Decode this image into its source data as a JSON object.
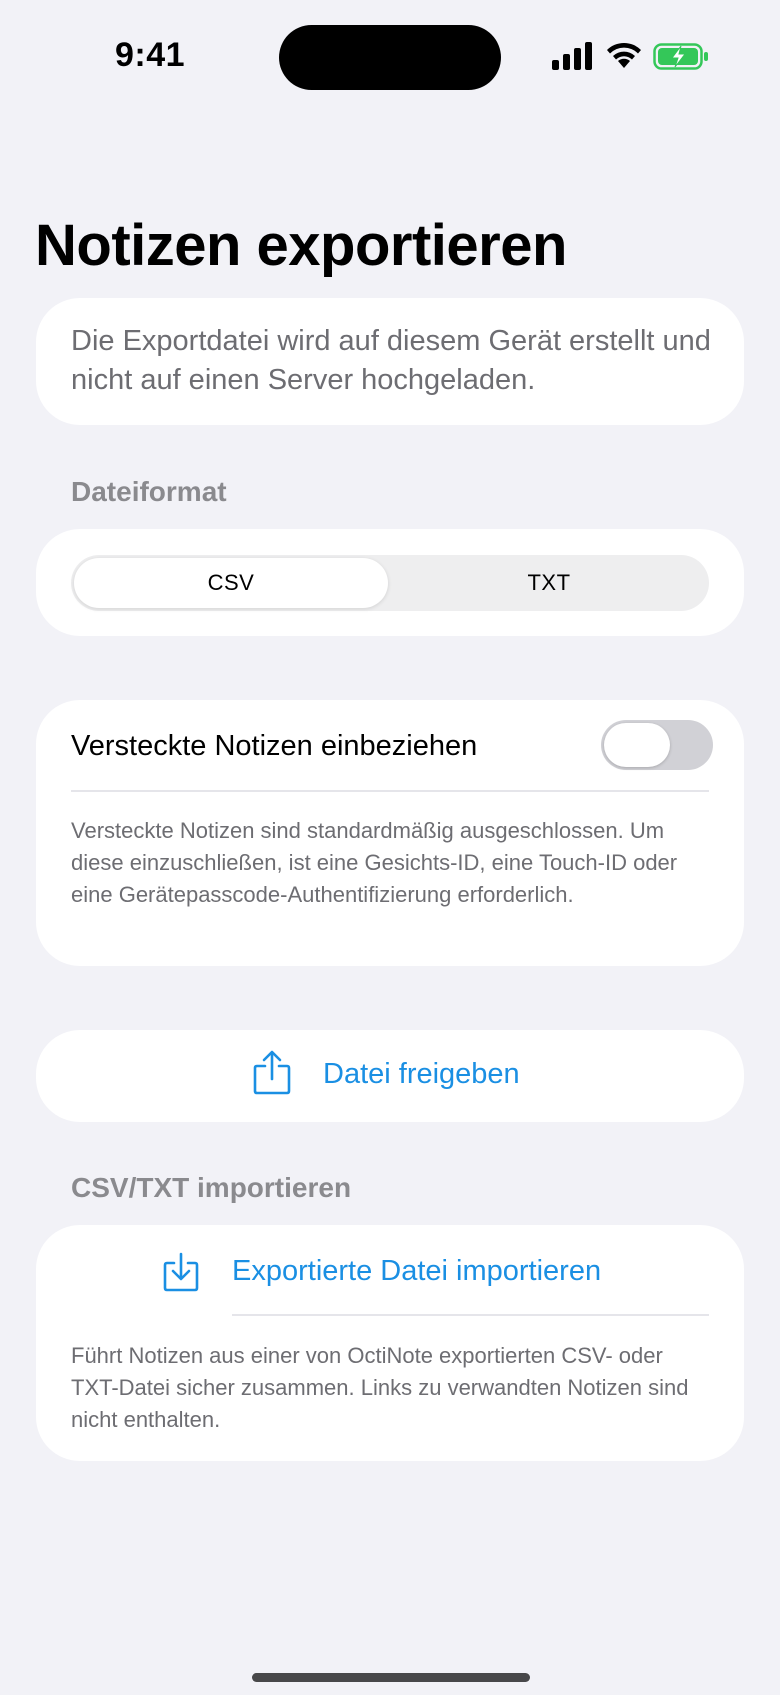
{
  "status_bar": {
    "time": "9:41"
  },
  "page": {
    "title": "Notizen exportieren"
  },
  "info": {
    "text": "Die Exportdatei wird auf diesem Gerät erstellt und nicht auf einen Server hochgeladen."
  },
  "format": {
    "header": "Dateiformat",
    "options": [
      "CSV",
      "TXT"
    ],
    "selected": "CSV"
  },
  "hidden_notes": {
    "label": "Versteckte Notizen einbeziehen",
    "enabled": false,
    "footnote": "Versteckte Notizen sind standardmäßig ausgeschlossen. Um diese einzuschließen, ist eine Gesichts-ID, eine Touch-ID oder eine Gerätepasscode-Authentifizierung erforderlich."
  },
  "share": {
    "label": "Datei freigeben",
    "icon": "share-icon"
  },
  "import": {
    "header": "CSV/TXT importieren",
    "label": "Exportierte Datei importieren",
    "icon": "import-icon",
    "footnote": "Führt Notizen aus einer von OctiNote exportierten CSV- oder TXT-Datei sicher zusammen. Links zu verwandten Notizen sind nicht enthalten."
  },
  "colors": {
    "accent": "#1a8fe3",
    "background": "#f2f2f7",
    "battery_green": "#34c759"
  }
}
